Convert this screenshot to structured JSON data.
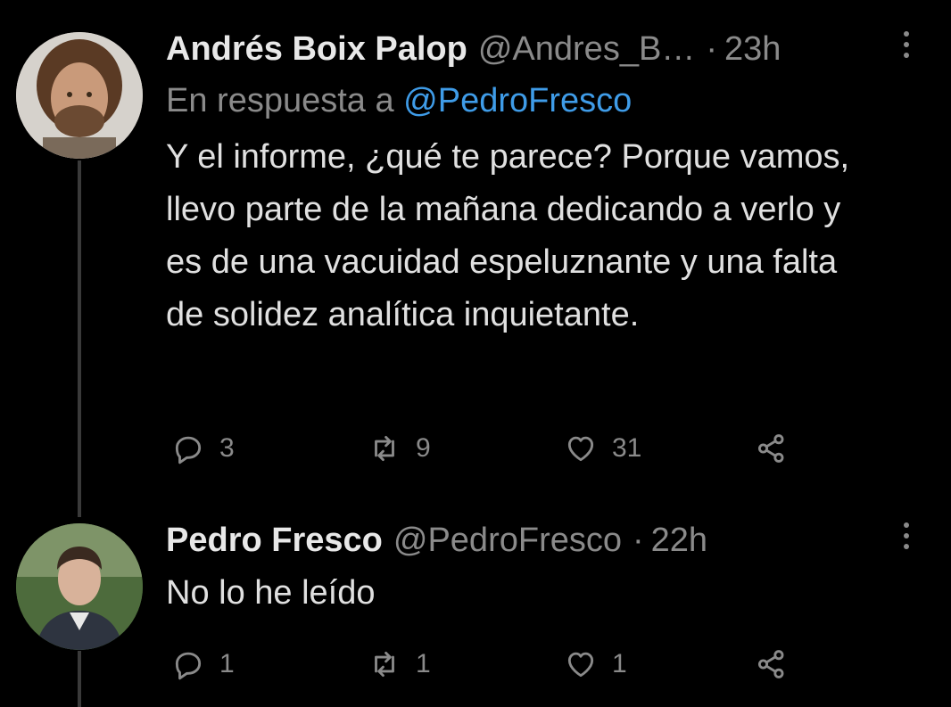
{
  "tweets": [
    {
      "name": "Andrés Boix Palop",
      "handle": "@Andres_B…",
      "time": "23h",
      "reply_prefix": "En respuesta a",
      "reply_mention": "@PedroFresco",
      "text": "Y el informe, ¿qué te parece? Porque vamos, llevo parte de la mañana dedicando a verlo y es de una vacuidad espeluznante y una falta de solidez analítica inquietante.",
      "replies": "3",
      "retweets": "9",
      "likes": "31"
    },
    {
      "name": "Pedro Fresco",
      "handle": "@PedroFresco",
      "time": "22h",
      "text": "No lo he leído",
      "replies": "1",
      "retweets": "1",
      "likes": "1"
    }
  ],
  "colors": {
    "background": "#000000",
    "link": "#3f9ce8",
    "muted": "#8a8a8a",
    "text": "#e0e0e0"
  },
  "icons": [
    "reply-icon",
    "retweet-icon",
    "like-icon",
    "share-icon",
    "more-icon"
  ]
}
